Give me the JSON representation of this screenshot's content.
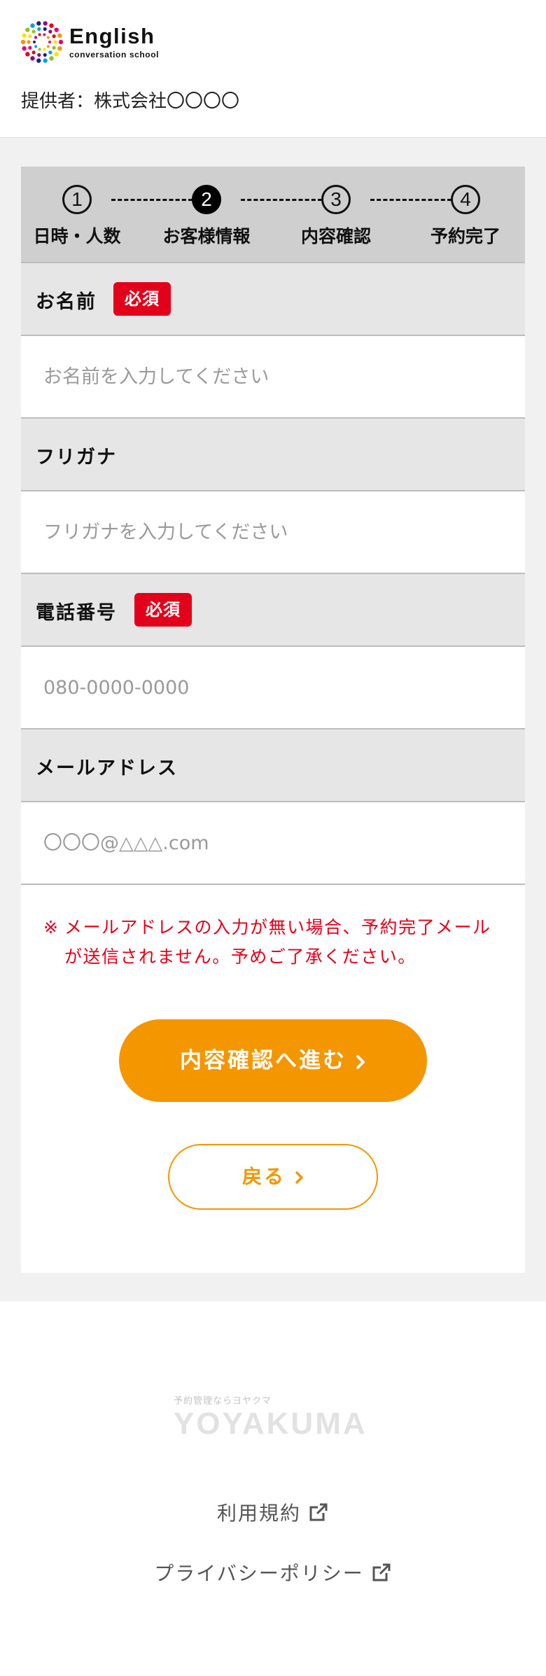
{
  "header": {
    "logo_main": "English",
    "logo_sub": "conversation school",
    "provider": "提供者：株式会社〇〇〇〇"
  },
  "stepper": {
    "steps": [
      {
        "number": "1",
        "label": "日時・人数"
      },
      {
        "number": "2",
        "label": "お客様情報"
      },
      {
        "number": "3",
        "label": "内容確認"
      },
      {
        "number": "4",
        "label": "予約完了"
      }
    ],
    "active_step": 2
  },
  "form": {
    "name": {
      "label": "お名前",
      "required_badge": "必須",
      "placeholder": "お名前を入力してください"
    },
    "furigana": {
      "label": "フリガナ",
      "placeholder": "フリガナを入力してください"
    },
    "phone": {
      "label": "電話番号",
      "required_badge": "必須",
      "placeholder": "080-0000-0000"
    },
    "email": {
      "label": "メールアドレス",
      "placeholder": "〇〇〇@△△△.com"
    }
  },
  "notice": {
    "mark": "※",
    "text": "メールアドレスの入力が無い場合、予約完了メールが送信されません。予めご了承ください。"
  },
  "buttons": {
    "next": "内容確認へ進む",
    "back": "戻る"
  },
  "footer": {
    "tagline": "予約管理ならヨヤクマ",
    "brand": "YOYAKUMA",
    "terms_link": "利用規約",
    "privacy_link": "プライバシーポリシー"
  },
  "colors": {
    "accent": "#f39600",
    "required": "#e3001b",
    "stepper_bg": "#cfcfcf",
    "label_bg": "#e6e6e6"
  },
  "icons": {
    "logo": "colorful-dot-ring-logo",
    "button_arrow": "chevron-right-icon",
    "external_link": "external-link-icon"
  }
}
